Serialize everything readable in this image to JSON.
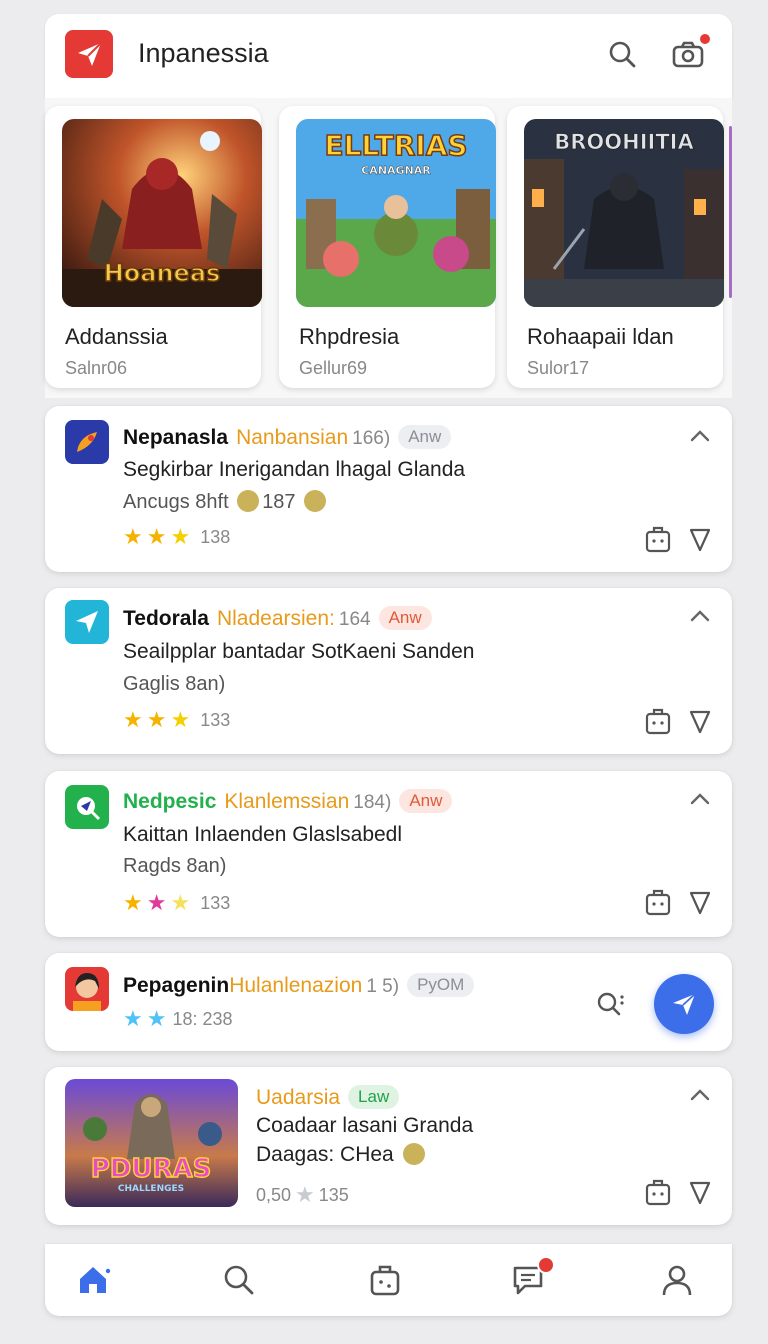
{
  "app": {
    "title": "Inpanessia"
  },
  "featured": [
    {
      "name": "Addanssia",
      "sub": "Salnr06",
      "art_text": "Hoaneas"
    },
    {
      "name": "Rhpdresia",
      "sub": "Gellur69",
      "art_text": "ELLTRIAS",
      "art_sub": "CANAGNAR"
    },
    {
      "name": "Rohaapaii ldan",
      "sub": "Sulor17",
      "art_text": "BROOHIITIA"
    }
  ],
  "list": [
    {
      "name": "Nepanasla",
      "sub": "Nanbansian",
      "count": "166)",
      "badge": "Anw",
      "line1": "Segkirbar Inerigandan lhagal Glanda",
      "line2a": "Ancugs 8hft",
      "line2b": "187",
      "rating": "138"
    },
    {
      "name": "Tedorala",
      "sub": "Nladearsien:",
      "count": "164",
      "badge": "Anw",
      "line1": "Seailpplar bantadar SotKaeni Sanden",
      "line2a": "Gaglis 8an)",
      "rating": "133"
    },
    {
      "name": "Nedpesic",
      "sub": "Klanlemssian",
      "count": "184)",
      "badge": "Anw",
      "line1": "Kaittan Inlaenden Glaslsabedl",
      "line2a": "Ragds 8an)",
      "rating": "133"
    },
    {
      "name": "Pepagenin",
      "sub": "Hulanlenazion",
      "count": "1 5)",
      "badge": "PyOM",
      "rating": "18: 238"
    },
    {
      "name": "Uadarsia",
      "badge": "Law",
      "line1": "Coadaar lasani Granda",
      "line2a": "Daagas: CHea",
      "rating_prefix": "0,50",
      "rating": "135",
      "art_text": "PDURAS",
      "art_sub": "CHALLENGES"
    }
  ],
  "colors": {
    "accent_blue": "#3b6ee8",
    "red": "#e53935",
    "orange": "#e89a1b",
    "green": "#22b14c",
    "star": "#f5b300"
  },
  "icons": [
    "search-icon",
    "camera-icon",
    "home-icon",
    "briefcase-icon",
    "chat-icon",
    "profile-icon",
    "send-icon",
    "chevron-up-icon",
    "share-icon",
    "down-triangle-icon"
  ]
}
